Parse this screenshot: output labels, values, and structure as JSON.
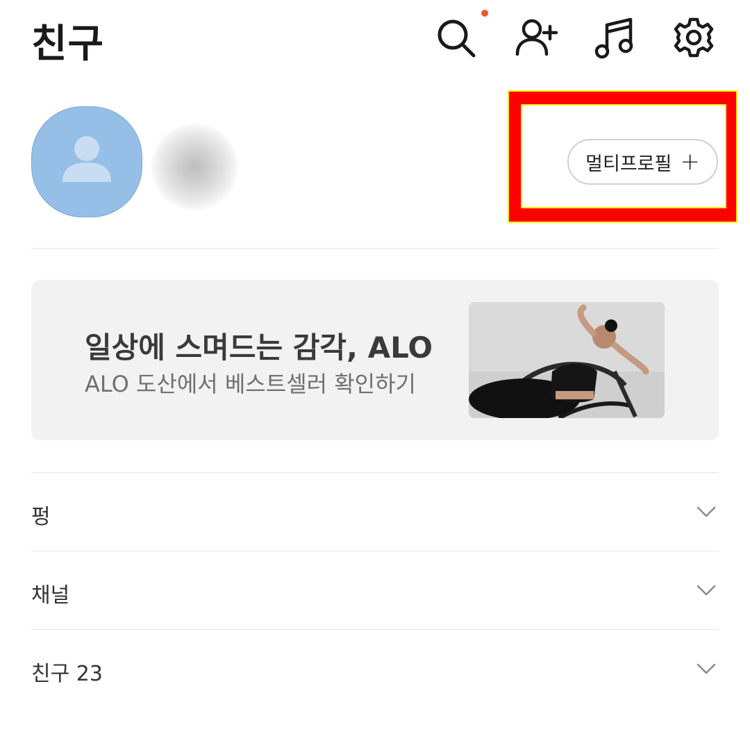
{
  "header": {
    "title": "친구",
    "icons": [
      "search-icon",
      "add-friend-icon",
      "music-icon",
      "settings-icon"
    ],
    "notification_dot_color": "#ea5a2a"
  },
  "profile": {
    "multi_profile_label": "멀티프로필",
    "multi_profile_plus": "+",
    "highlight_colors": {
      "outer": "#ff0000",
      "border": "#f2f200"
    }
  },
  "banner": {
    "title": "일상에 스며드는 감각, ALO",
    "subtitle": "ALO 도산에서 베스트셀러 확인하기"
  },
  "sections": [
    {
      "label": "펑"
    },
    {
      "label": "채널"
    },
    {
      "label": "친구 23"
    }
  ],
  "colors": {
    "avatar": "#95bfe6",
    "banner_bg": "#f2f2f2"
  }
}
